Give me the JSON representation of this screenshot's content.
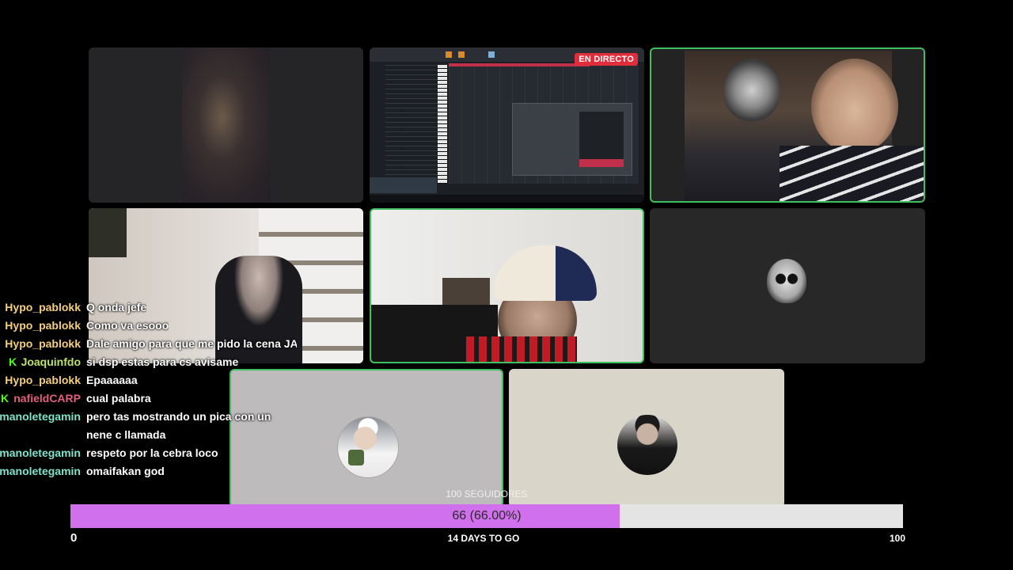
{
  "call": {
    "live_badge": "EN DIRECTO"
  },
  "chat": [
    {
      "user": "Hypo_pablokk",
      "color": "#f5cf7a",
      "badge": "",
      "text": "Q onda jefe"
    },
    {
      "user": "Hypo_pablokk",
      "color": "#f5cf7a",
      "badge": "",
      "text": "Como va esooo"
    },
    {
      "user": "Hypo_pablokk",
      "color": "#f5cf7a",
      "badge": "",
      "text": "Dale amigo para que me pido la cena JAJ"
    },
    {
      "user": "Joaquinfdo",
      "color": "#bde36b",
      "badge": "kick-badge-icon",
      "text": "si dsp estas para cs avisame"
    },
    {
      "user": "Hypo_pablokk",
      "color": "#f5cf7a",
      "badge": "",
      "text": "Epaaaaaa"
    },
    {
      "user": "nafieldCARP",
      "color": "#e0607c",
      "badge": "kick-badge-icon",
      "text": "cual palabra"
    },
    {
      "user": "manoletegamin",
      "color": "#7ee3c8",
      "badge": "",
      "text": "pero tas mostrando un pica con un nene c llamada"
    },
    {
      "user": "manoletegamin",
      "color": "#7ee3c8",
      "badge": "",
      "text": "respeto por la cebra loco"
    },
    {
      "user": "manoletegamin",
      "color": "#7ee3c8",
      "badge": "",
      "text": "omaifakan god"
    }
  ],
  "goal": {
    "title": "100 SEGUIDORES",
    "current": 66,
    "target": 100,
    "value_label": "66 (66.00%)",
    "fraction": 0.66,
    "min_label": "0",
    "max_label": "100",
    "days_label": "14 DAYS TO GO",
    "fill_color": "#d070ec",
    "track_color": "#e4e4e4"
  },
  "colors": {
    "speaking_border": "#3fbf5f",
    "live_badge_bg": "#e02d3c"
  }
}
